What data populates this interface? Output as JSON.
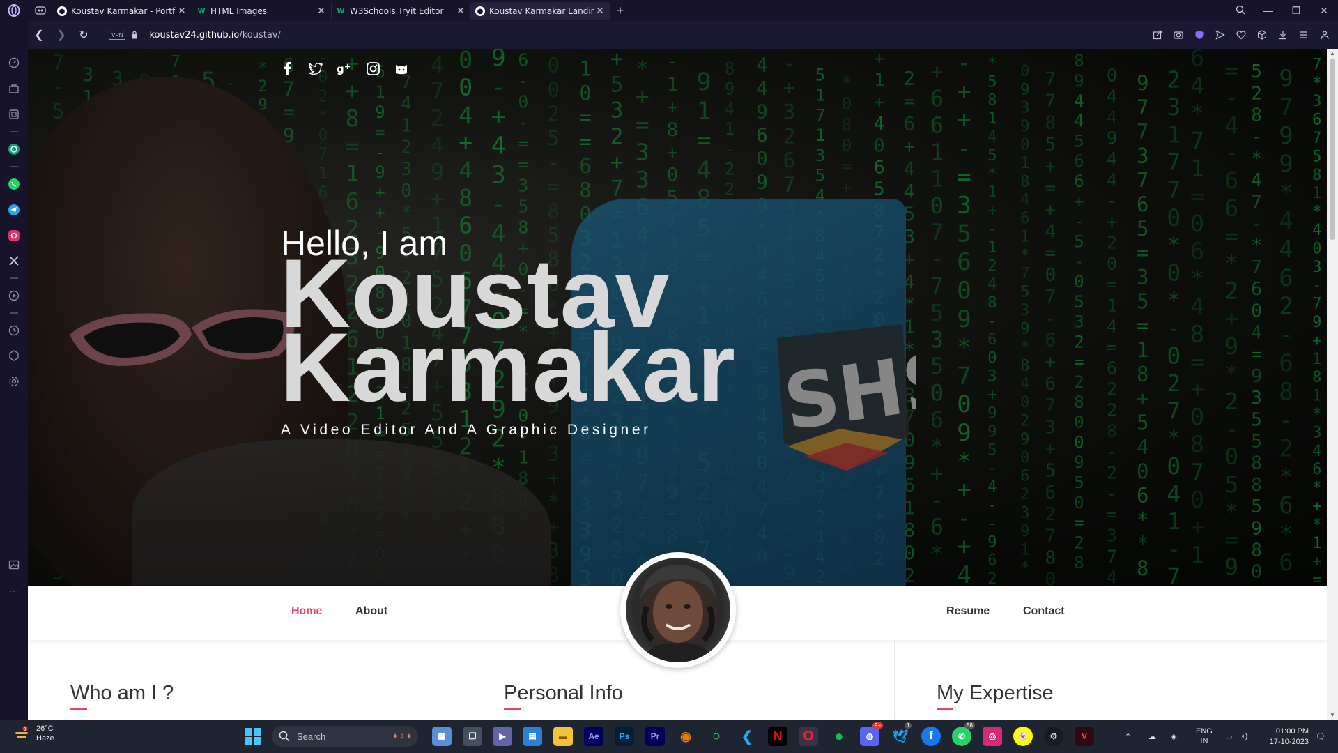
{
  "browser": {
    "tabs": [
      {
        "title": "Koustav Karmakar - Portfoli",
        "favicon": "github-icon",
        "active": false
      },
      {
        "title": "HTML Images",
        "favicon": "w3schools-icon",
        "active": false
      },
      {
        "title": "W3Schools Tryit Editor",
        "favicon": "w3schools-icon",
        "active": false
      },
      {
        "title": "Koustav Karmakar Landing",
        "favicon": "github-icon",
        "active": true
      }
    ],
    "new_tab_label": "+",
    "address": {
      "vpn_label": "VPN",
      "url_host": "koustav24.github.io",
      "url_path": "/koustav/"
    }
  },
  "hero": {
    "greeting": "Hello, I am",
    "first_name": "Koustav",
    "last_name": "Karmakar",
    "tagline": "A Video Editor And A Graphic Designer",
    "socials": [
      "facebook-icon",
      "twitter-icon",
      "google-plus-icon",
      "instagram-icon",
      "github-icon"
    ],
    "matrix_color": "#1fd655"
  },
  "nav": {
    "left": [
      {
        "label": "Home",
        "active": true
      },
      {
        "label": "About",
        "active": false
      }
    ],
    "right": [
      {
        "label": "Resume",
        "active": false
      },
      {
        "label": "Contact",
        "active": false
      }
    ],
    "accent": "#e8435a"
  },
  "sections": [
    {
      "title": "Who am I ?"
    },
    {
      "title": "Personal Info"
    },
    {
      "title": "My Expertise"
    }
  ],
  "taskbar": {
    "weather": {
      "temp": "26°C",
      "condition": "Haze",
      "badge": "1"
    },
    "search_label": "Search",
    "apps": [
      "widgets",
      "task-view",
      "teams",
      "store",
      "file-explorer",
      "after-effects",
      "photoshop",
      "premiere-pro",
      "blender",
      "opera-gx",
      "vscode",
      "netflix",
      "opera",
      "spotify",
      "discord",
      "twitter",
      "facebook",
      "whatsapp",
      "instagram",
      "snapchat",
      "steam",
      "app"
    ],
    "badges": {
      "discord": "9+",
      "twitter": "1",
      "whatsapp": "58"
    },
    "tray": {
      "lang": "ENG",
      "region": "IN"
    },
    "clock": {
      "time": "01:00 PM",
      "date": "17-10-2023"
    }
  }
}
